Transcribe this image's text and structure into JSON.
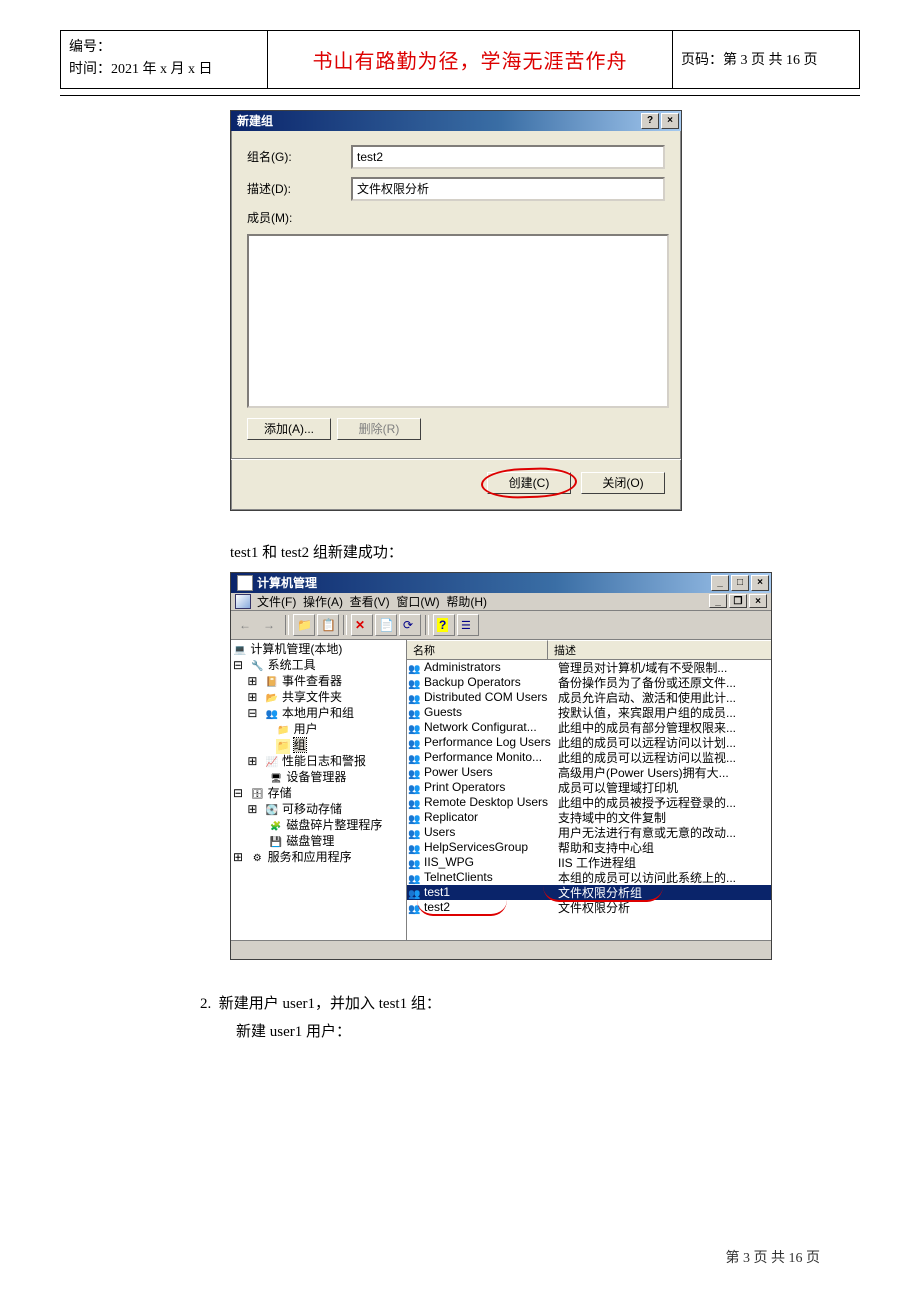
{
  "header": {
    "numLabel": "编号：",
    "timeLabel": "时间：2021 年 x 月 x 日",
    "motto": "书山有路勤为径，学海无涯苦作舟",
    "pageLabel": "页码：第 3 页 共 16 页"
  },
  "dialog": {
    "title": "新建组",
    "helpBtn": "?",
    "closeBtn": "×",
    "groupLabel": "组名(G):",
    "groupValue": "test2",
    "descLabel": "描述(D):",
    "descValue": "文件权限分析",
    "membersLabel": "成员(M):",
    "addBtn": "添加(A)...",
    "removeBtn": "删除(R)",
    "createBtn": "创建(C)",
    "closeBtn2": "关闭(O)"
  },
  "text1": "test1 和 test2 组新建成功：",
  "mmc": {
    "title": "计算机管理",
    "menu": {
      "file": "文件(F)",
      "action": "操作(A)",
      "view": "查看(V)",
      "window": "窗口(W)",
      "help": "帮助(H)"
    },
    "treeHeader": "计算机管理(本地)",
    "tree": {
      "root": "计算机管理(本地)",
      "sysTools": "系统工具",
      "eventViewer": "事件查看器",
      "sharedFolders": "共享文件夹",
      "localUsers": "本地用户和组",
      "users": "用户",
      "groups": "组",
      "perfLogs": "性能日志和警报",
      "devMgr": "设备管理器",
      "storage": "存储",
      "removable": "可移动存储",
      "defrag": "磁盘碎片整理程序",
      "diskMgmt": "磁盘管理",
      "services": "服务和应用程序"
    },
    "listHdr": {
      "name": "名称",
      "desc": "描述"
    },
    "groups": [
      {
        "name": "Administrators",
        "desc": "管理员对计算机/域有不受限制..."
      },
      {
        "name": "Backup Operators",
        "desc": "备份操作员为了备份或还原文件..."
      },
      {
        "name": "Distributed COM Users",
        "desc": "成员允许启动、激活和使用此计..."
      },
      {
        "name": "Guests",
        "desc": "按默认值，来宾跟用户组的成员..."
      },
      {
        "name": "Network Configurat...",
        "desc": "此组中的成员有部分管理权限来..."
      },
      {
        "name": "Performance Log Users",
        "desc": "此组的成员可以远程访问以计划..."
      },
      {
        "name": "Performance Monito...",
        "desc": "此组的成员可以远程访问以监视..."
      },
      {
        "name": "Power Users",
        "desc": "高级用户(Power Users)拥有大..."
      },
      {
        "name": "Print Operators",
        "desc": "成员可以管理域打印机"
      },
      {
        "name": "Remote Desktop Users",
        "desc": "此组中的成员被授予远程登录的..."
      },
      {
        "name": "Replicator",
        "desc": "支持域中的文件复制"
      },
      {
        "name": "Users",
        "desc": "用户无法进行有意或无意的改动..."
      },
      {
        "name": "HelpServicesGroup",
        "desc": "帮助和支持中心组"
      },
      {
        "name": "IIS_WPG",
        "desc": "IIS 工作进程组"
      },
      {
        "name": "TelnetClients",
        "desc": "本组的成员可以访问此系统上的..."
      },
      {
        "name": "test1",
        "desc": "文件权限分析组"
      },
      {
        "name": "test2",
        "desc": "文件权限分析"
      }
    ]
  },
  "step2": {
    "num": "2.",
    "line1": "新建用户 user1，并加入 test1 组：",
    "line2": "新建 user1 用户："
  },
  "footer": "第 3 页 共 16 页"
}
